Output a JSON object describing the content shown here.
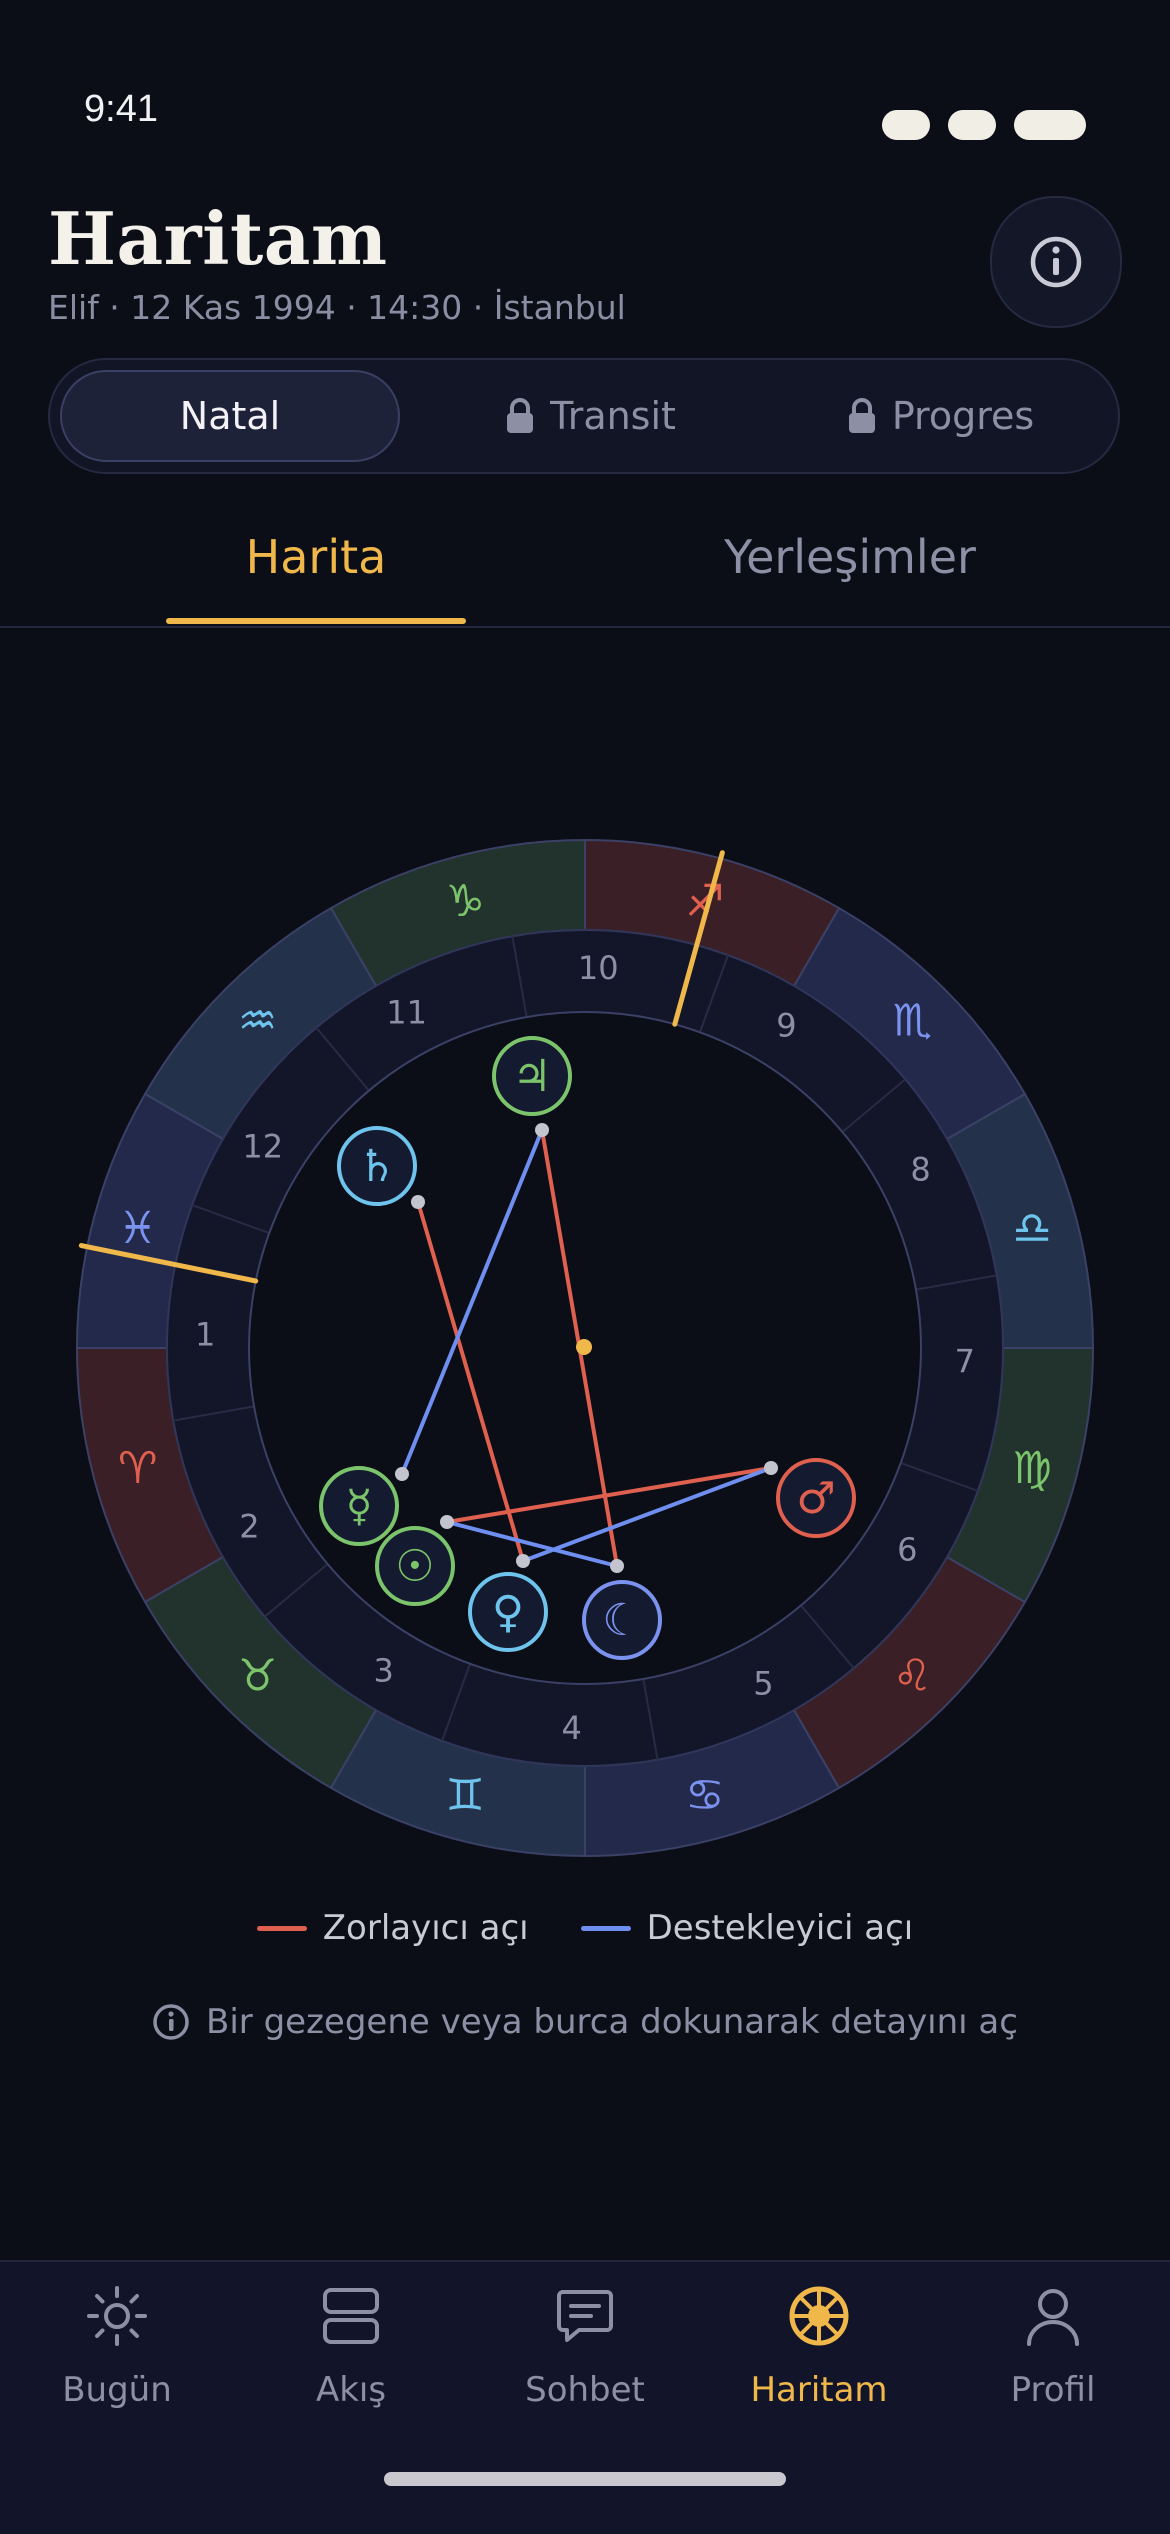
{
  "status_bar": {
    "time": "9:41"
  },
  "header": {
    "title": "Haritam",
    "subtitle": "Elif · 12 Kas 1994 · 14:30 · İstanbul"
  },
  "segments": [
    {
      "label": "Natal",
      "active": true,
      "locked": false
    },
    {
      "label": "Transit",
      "active": false,
      "locked": true
    },
    {
      "label": "Progres",
      "active": false,
      "locked": true
    }
  ],
  "tabs": [
    {
      "label": "Harita",
      "active": true
    },
    {
      "label": "Yerleşimler",
      "active": false
    }
  ],
  "chart_data": {
    "type": "natal-wheel",
    "signs": [
      {
        "name": "Aries",
        "glyph": "♈",
        "color": "#e0604f"
      },
      {
        "name": "Taurus",
        "glyph": "♉",
        "color": "#7bc46b"
      },
      {
        "name": "Gemini",
        "glyph": "♊",
        "color": "#6ec4ec"
      },
      {
        "name": "Cancer",
        "glyph": "♋",
        "color": "#7b93ef"
      },
      {
        "name": "Leo",
        "glyph": "♌",
        "color": "#e0604f"
      },
      {
        "name": "Virgo",
        "glyph": "♍",
        "color": "#7bc46b"
      },
      {
        "name": "Libra",
        "glyph": "♎",
        "color": "#6ec4ec"
      },
      {
        "name": "Scorpio",
        "glyph": "♏",
        "color": "#7b93ef"
      },
      {
        "name": "Sagittarius",
        "glyph": "♐",
        "color": "#e0604f"
      },
      {
        "name": "Capricorn",
        "glyph": "♑",
        "color": "#7bc46b"
      },
      {
        "name": "Aquarius",
        "glyph": "♒",
        "color": "#6ec4ec"
      },
      {
        "name": "Pisces",
        "glyph": "♓",
        "color": "#7b93ef"
      }
    ],
    "houses": [
      "1",
      "2",
      "3",
      "4",
      "5",
      "6",
      "7",
      "8",
      "9",
      "10",
      "11",
      "12"
    ],
    "planets": [
      {
        "name": "Jupiter",
        "glyph": "♃",
        "color": "#7bc46b"
      },
      {
        "name": "Saturn",
        "glyph": "♄",
        "color": "#6ec4ec"
      },
      {
        "name": "Mercury",
        "glyph": "☿",
        "color": "#7bc46b"
      },
      {
        "name": "Sun",
        "glyph": "☉",
        "color": "#7bc46b"
      },
      {
        "name": "Venus",
        "glyph": "♀",
        "color": "#6ec4ec"
      },
      {
        "name": "Moon",
        "glyph": "☾",
        "color": "#7b93ef"
      },
      {
        "name": "Mars",
        "glyph": "♂",
        "color": "#e0604f"
      }
    ],
    "aspects": [
      {
        "from": "Saturn",
        "to": "Venus",
        "kind": "hard"
      },
      {
        "from": "Jupiter",
        "to": "Moon",
        "kind": "hard"
      },
      {
        "from": "Sun",
        "to": "Mars",
        "kind": "hard"
      },
      {
        "from": "Jupiter",
        "to": "Mercury",
        "kind": "soft"
      },
      {
        "from": "Venus",
        "to": "Mars",
        "kind": "soft"
      },
      {
        "from": "Sun",
        "to": "Moon",
        "kind": "soft"
      }
    ],
    "colors": {
      "hard": "#e0604f",
      "soft": "#6f8ff0",
      "axis": "#f0b84a"
    }
  },
  "legend": {
    "hard": "Zorlayıcı açı",
    "soft": "Destekleyici açı"
  },
  "hint": "Bir gezegene veya burca dokunarak detayını aç",
  "nav": [
    {
      "label": "Bugün",
      "icon": "sun-icon",
      "active": false
    },
    {
      "label": "Akış",
      "icon": "feed-icon",
      "active": false
    },
    {
      "label": "Sohbet",
      "icon": "chat-icon",
      "active": false
    },
    {
      "label": "Haritam",
      "icon": "wheel-icon",
      "active": true
    },
    {
      "label": "Profil",
      "icon": "profile-icon",
      "active": false
    }
  ],
  "theme": {
    "accent": "#f0b84a",
    "background": "#0b0d17"
  }
}
